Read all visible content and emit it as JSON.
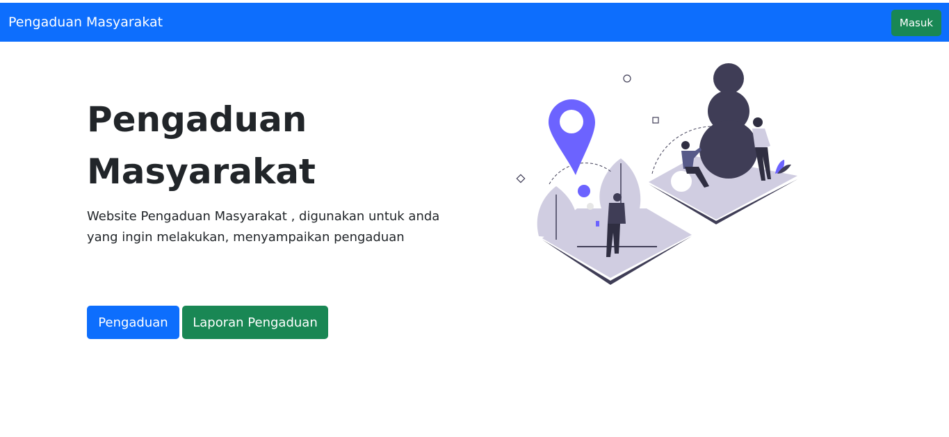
{
  "navbar": {
    "brand": "Pengaduan Masyarakat",
    "login_label": "Masuk",
    "color": "#0d6efd"
  },
  "hero": {
    "title": "Pengaduan Masyarakat",
    "description": "Website Pengaduan Masyarakat , digunakan untuk anda yang ingin melakukan, menyampaikan pengaduan",
    "primary_button": "Pengaduan",
    "secondary_button": "Laporan Pengaduan",
    "illustration": "location-pin-people-illustration"
  },
  "colors": {
    "primary": "#0d6efd",
    "success": "#198754",
    "accent": "#6c63ff",
    "dark": "#3f3d56",
    "platform": "#d0cde1"
  }
}
